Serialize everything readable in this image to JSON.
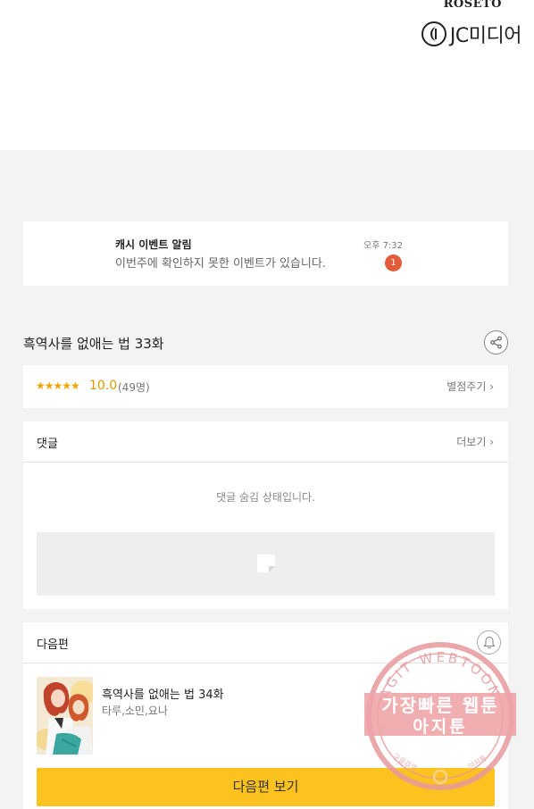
{
  "banner": {
    "publisher_top": "ROSETO",
    "publisher_logo_text": "JC미디어"
  },
  "notification": {
    "title": "캐시 이벤트 알림",
    "message": "이번주에 확인하지 못한 이벤트가 있습니다.",
    "time": "오후 7:32",
    "badge_count": "1"
  },
  "episode": {
    "title": "흑역사를 없애는 법 33화",
    "share_icon": "share-icon"
  },
  "rating": {
    "stars": "★★★★★",
    "score": "10.0",
    "count": "(49명)",
    "rate_link": "별점주기 ›"
  },
  "comments": {
    "title": "댓글",
    "more_link": "더보기 ›",
    "hidden_message": "댓글 숨김 상태입니다."
  },
  "next_episode": {
    "section_title": "다음편",
    "title": "흑역사를 없애는 법 34화",
    "authors": "타루,소민,요나",
    "button_label": "다음편 보기",
    "bell_icon": "bell-icon"
  },
  "watermark": {
    "arc_text": "AGIT WEBTOON",
    "line1": "가장빠른 웹툰",
    "line2": "아지툰",
    "small_left": "구글검색",
    "small_right": "아지툰"
  },
  "colors": {
    "accent_yellow": "#fcc21f",
    "badge_red": "#e25c3b",
    "star_orange": "#f0a400"
  }
}
